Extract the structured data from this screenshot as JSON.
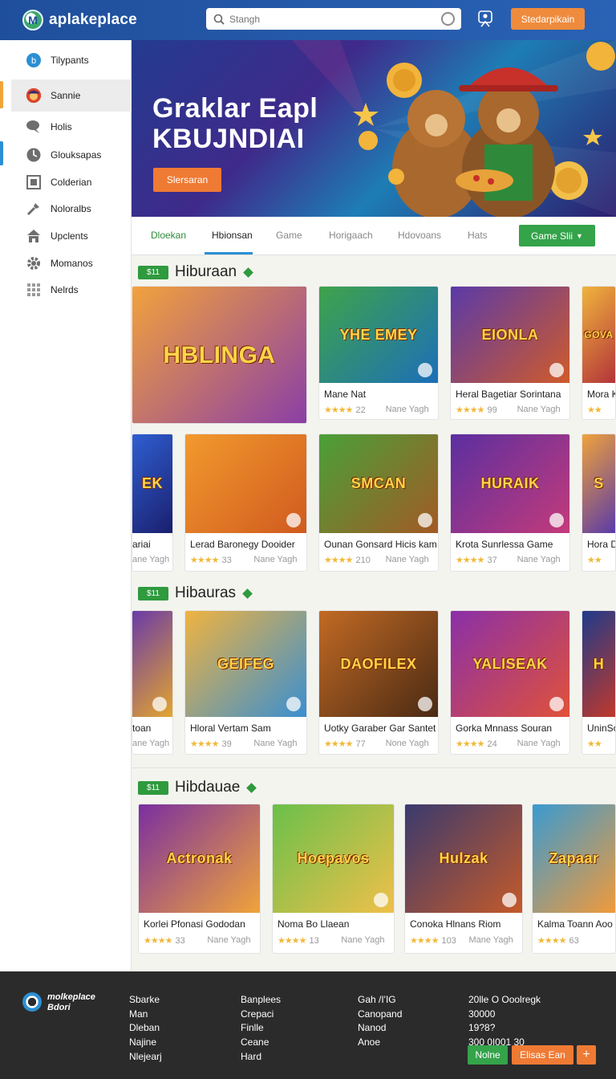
{
  "app": {
    "name": "aplakeplace"
  },
  "search": {
    "placeholder": "Stangh",
    "value": ""
  },
  "header": {
    "cta_label": "Stedarpikain"
  },
  "sidebar": {
    "items": [
      {
        "label": "Tilypants",
        "icon": "circle-b-icon"
      },
      {
        "label": "Sannie",
        "icon": "game-avatar-icon"
      },
      {
        "label": "Holis",
        "icon": "chat-icon"
      },
      {
        "label": "Glouksapas",
        "icon": "clock-icon"
      },
      {
        "label": "Colderian",
        "icon": "calendar-icon"
      },
      {
        "label": "Noloralbs",
        "icon": "tools-icon"
      },
      {
        "label": "Upclents",
        "icon": "home-icon"
      },
      {
        "label": "Momanos",
        "icon": "gear-icon"
      },
      {
        "label": "Nelrds",
        "icon": "grid-icon"
      }
    ]
  },
  "hero": {
    "title_line1": "Graklar Eapl",
    "title_line2": "KBUJNDIAI",
    "button_label": "Slersaran"
  },
  "tabs": {
    "items": [
      "Dloekan",
      "Hbionsan",
      "Game",
      "Horigaach",
      "Hdovoans",
      "Hats"
    ],
    "active": "Hbionsan",
    "cta_label": "Game Slii"
  },
  "sections": [
    {
      "badge": "$11",
      "title": "Hiburaan",
      "cards": [
        {
          "art": "HBLINGA",
          "name": "",
          "rating": "",
          "label": "",
          "colors": [
            "#f2a23c",
            "#8a3ea6"
          ]
        },
        {
          "art": "YHE EMEY",
          "name": "Mane Nat",
          "rating": "22",
          "label": "Nane Yagh",
          "colors": [
            "#3fa34a",
            "#1c6fb8"
          ]
        },
        {
          "art": "EIONLA",
          "name": "Heral Bagetiar Sorintana",
          "rating": "99",
          "label": "Nane Yagh",
          "colors": [
            "#5a3aa8",
            "#d05b2a"
          ]
        },
        {
          "art": "GOVA",
          "name": "Mora K",
          "rating": "",
          "label": "",
          "colors": [
            "#f0b43c",
            "#b3343a"
          ]
        }
      ]
    },
    {
      "badge": "",
      "title": "",
      "cards": [
        {
          "art": "EK",
          "name": "ariai",
          "rating": "",
          "label": "ane Yagh",
          "colors": [
            "#2f5fd1",
            "#1a1f6e"
          ]
        },
        {
          "art": "",
          "name": "Lerad Baronegy Dooider",
          "rating": "33",
          "label": "Nane Yagh",
          "colors": [
            "#f29a2e",
            "#d05a1e"
          ]
        },
        {
          "art": "SMCAN",
          "name": "Ounan Gonsard Hicis kam",
          "rating": "210",
          "label": "Nane Yagh",
          "colors": [
            "#4aa03a",
            "#a25a24"
          ]
        },
        {
          "art": "HURAIK",
          "name": "Krota Sunrlessa Game",
          "rating": "37",
          "label": "Nane Yagh",
          "colors": [
            "#5b2fa0",
            "#c43a7a"
          ]
        },
        {
          "art": "S",
          "name": "Hora D",
          "rating": "",
          "label": "",
          "colors": [
            "#f0a23a",
            "#5a3aa8"
          ]
        }
      ]
    },
    {
      "badge": "$11",
      "title": "Hibauras",
      "cards": [
        {
          "art": "",
          "name": "toan",
          "rating": "",
          "label": "ane Yagh",
          "colors": [
            "#6a3aa8",
            "#e3a52e"
          ]
        },
        {
          "art": "GEIFEG",
          "name": "Hloral Vertam Sam",
          "rating": "39",
          "label": "Nane Yagh",
          "colors": [
            "#f0b340",
            "#3a8fd1"
          ]
        },
        {
          "art": "DAOFILEX",
          "name": "Uotky Garaber Gar Santet",
          "rating": "77",
          "label": "None Yagh",
          "colors": [
            "#c26a24",
            "#4a2a14"
          ]
        },
        {
          "art": "YALISEAK",
          "name": "Gorka Mnnass Souran",
          "rating": "24",
          "label": "Nane Yagh",
          "colors": [
            "#8a2fa8",
            "#e0523a"
          ]
        },
        {
          "art": "H",
          "name": "UninSo",
          "rating": "",
          "label": "",
          "colors": [
            "#1f3a8a",
            "#c0392b"
          ]
        }
      ]
    },
    {
      "badge": "$11",
      "title": "Hibdauae",
      "cards": [
        {
          "art": "Actronak",
          "name": "Korlei Pfonasi Gododan",
          "rating": "33",
          "label": "Nane Yagh",
          "colors": [
            "#7a2fa0",
            "#f0a43a"
          ]
        },
        {
          "art": "Hoepavos",
          "name": "Noma Bo Llaean",
          "rating": "13",
          "label": "Nane Yagh",
          "colors": [
            "#6ac04a",
            "#f0c04a"
          ]
        },
        {
          "art": "Hulzak",
          "name": "Conoka Hlnans Riom",
          "rating": "103",
          "label": "Mane Yagh",
          "colors": [
            "#3a3a6e",
            "#c45a2a"
          ]
        },
        {
          "art": "Zapaar",
          "name": "Kalma Toann Aoo",
          "rating": "63",
          "label": "",
          "colors": [
            "#3a9ad1",
            "#f09a3a"
          ]
        }
      ]
    }
  ],
  "footer": {
    "logo_line1": "molkeplace",
    "logo_line2": "Bdori",
    "col1": [
      "Sbarke",
      "Man",
      "Dleban",
      "Najine",
      "Nlejearj"
    ],
    "col2": [
      "Banplees",
      "Crepaci",
      "Finlle",
      "Ceane",
      "Hard"
    ],
    "col3": [
      "Gah /I'IG",
      "Canopand",
      "Nanod",
      "Anoe"
    ],
    "col4": [
      "20lle O Ooolregk",
      "30000",
      "19?8?",
      "300 0|001 30"
    ],
    "btn1": "Nolne",
    "btn2": "Elisas Ean",
    "btn3": "+"
  }
}
